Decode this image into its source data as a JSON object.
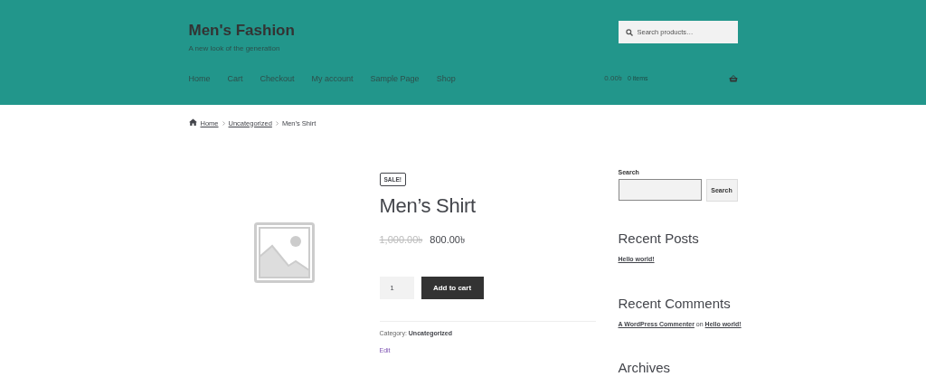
{
  "site": {
    "title": "Men's Fashion",
    "tagline": "A new look of the generation"
  },
  "search": {
    "placeholder": "Search products…"
  },
  "nav": [
    "Home",
    "Cart",
    "Checkout",
    "My account",
    "Sample Page",
    "Shop"
  ],
  "cart": {
    "total": "0.00৳",
    "count": "0 items"
  },
  "breadcrumb": [
    {
      "label": "Home",
      "link": true
    },
    {
      "label": "Uncategorized",
      "link": true
    },
    {
      "label": "Men’s Shirt",
      "link": false
    }
  ],
  "product": {
    "badge": "SALE!",
    "title": "Men’s Shirt",
    "old_price": "1,000.00৳",
    "price": "800.00৳",
    "quantity": "1",
    "button": "Add to cart",
    "category_label": "Category:",
    "category": "Uncategorized",
    "edit": "Edit"
  },
  "sidebar": {
    "search_label": "Search",
    "search_button": "Search",
    "widgets": [
      {
        "title": "Recent Posts",
        "parts": [
          {
            "text": "Hello world!",
            "link": true
          }
        ]
      },
      {
        "title": "Recent Comments",
        "parts": [
          {
            "text": "A WordPress Commenter",
            "link": true
          },
          {
            "text": " on ",
            "link": false
          },
          {
            "text": "Hello world!",
            "link": true
          }
        ]
      },
      {
        "title": "Archives"
      }
    ]
  }
}
